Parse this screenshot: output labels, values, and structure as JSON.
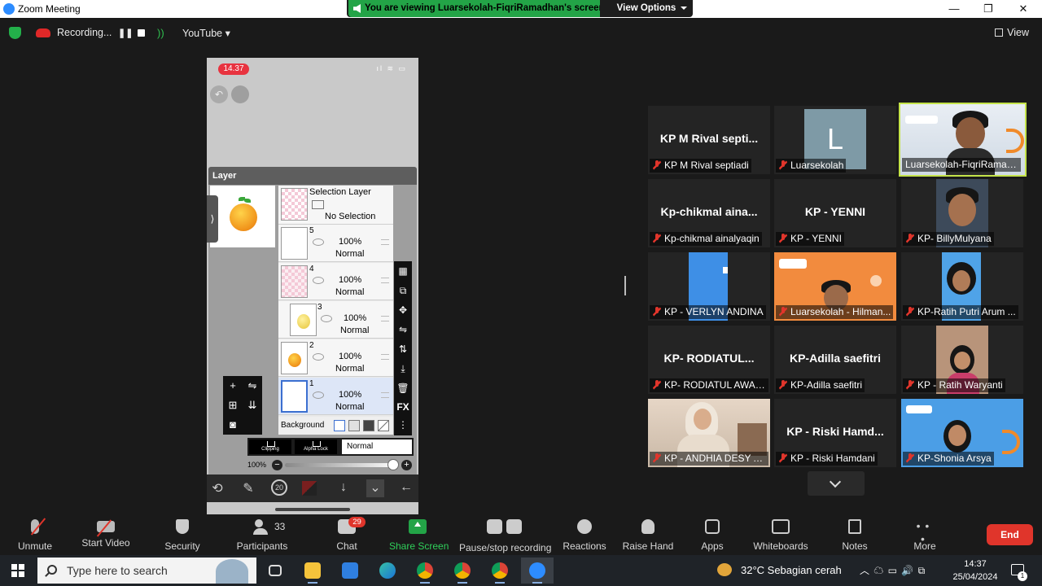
{
  "window": {
    "title": "Zoom Meeting",
    "minimize_label": "—",
    "maximize_label": "❐",
    "close_label": "✕"
  },
  "share_banner": {
    "text": "You are viewing Luarsekolah-FiqriRamadhan's screen",
    "view_options_label": "View Options"
  },
  "status_bar": {
    "recording_label": "Recording...",
    "pause_glyph": "❚❚",
    "stream_label": "YouTube ▾",
    "view_label": "View"
  },
  "phone": {
    "time": "14.37",
    "status_icons": "ıl ≋ ▭",
    "undo_glyph": "↶",
    "layer_header": "Layer",
    "expand_glyph": "⟩",
    "selection_layer": {
      "title": "Selection Layer",
      "status": "No Selection"
    },
    "layers": [
      {
        "num": "5",
        "opacity": "100%",
        "mode": "Normal"
      },
      {
        "num": "4",
        "opacity": "100%",
        "mode": "Normal"
      },
      {
        "num": "3",
        "opacity": "100%",
        "mode": "Normal"
      },
      {
        "num": "2",
        "opacity": "100%",
        "mode": "Normal"
      },
      {
        "num": "1",
        "opacity": "100%",
        "mode": "Normal"
      }
    ],
    "background_label": "Background",
    "clipping_label": "Clipping",
    "alpha_lock_label": "Alpha Lock",
    "blend_mode": "Normal",
    "opacity_value": "100%",
    "minus_glyph": "−",
    "plus_glyph": "+",
    "fx_label": "FX"
  },
  "gallery": {
    "tiles": [
      {
        "big_name": "KP M Rival septi...",
        "name": "KP M Rival septiadi"
      },
      {
        "avatar_letter": "L",
        "name": "Luarsekolah"
      },
      {
        "name": "Luarsekolah-FiqriRamad..."
      },
      {
        "big_name": "Kp-chikmal  aina...",
        "name": "Kp-chikmal ainalyaqin"
      },
      {
        "big_name": "KP - YENNI",
        "name": "KP - YENNI"
      },
      {
        "name": "KP- BillyMulyana"
      },
      {
        "name": "KP - VERLYN ANDINA"
      },
      {
        "name": "Luarsekolah - Hilman..."
      },
      {
        "name": "KP-Ratih Putri Arum ..."
      },
      {
        "big_name": "KP-  RODIATUL...",
        "name": "KP- RODIATUL AWALI..."
      },
      {
        "big_name": "KP-Adilla saefitri",
        "name": "KP-Adilla saefitri"
      },
      {
        "name": "KP - Ratih Waryanti"
      },
      {
        "name": "KP - ANDHIA DESY A..."
      },
      {
        "big_name": "KP - Riski Hamd...",
        "name": "KP - Riski Hamdani"
      },
      {
        "name": "KP-Shonia Arsya"
      }
    ]
  },
  "toolbar": {
    "unmute": "Unmute",
    "start_video": "Start Video",
    "security": "Security",
    "participants": "Participants",
    "participants_count": "33",
    "chat": "Chat",
    "chat_badge": "29",
    "share_screen": "Share Screen",
    "pause_recording": "Pause/stop recording",
    "reactions": "Reactions",
    "raise_hand": "Raise Hand",
    "apps": "Apps",
    "whiteboards": "Whiteboards",
    "notes": "Notes",
    "more": "More",
    "end": "End"
  },
  "taskbar": {
    "search_placeholder": "Type here to search",
    "weather": "32°C  Sebagian cerah",
    "tray_icons": "︿  ☁  ▭  🔊  ⧉",
    "time": "14:37",
    "date": "25/04/2024",
    "notification_count": "1"
  },
  "colors": {
    "share_green": "#23a447",
    "end_red": "#e0352b",
    "active_speaker_border": "#c4e34a",
    "recording_red": "#e02828"
  }
}
